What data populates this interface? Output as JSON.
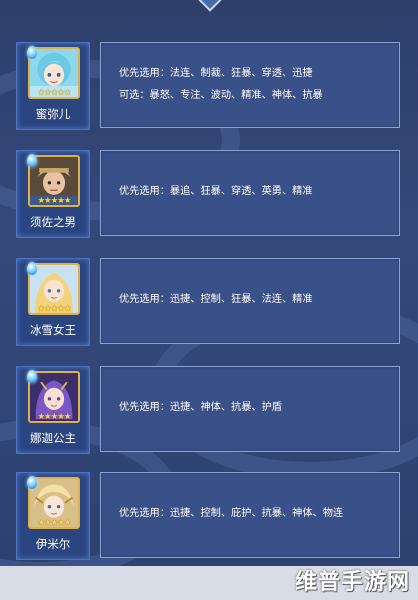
{
  "colors": {
    "panel_bg": "#34487a",
    "info_bg": "#3a5088",
    "info_border": "#8aa3d6",
    "star": "#ffd43a",
    "portrait_border": "#e0b04a"
  },
  "heroes": [
    {
      "name": "蜜弥儿",
      "stars": "★★★★★",
      "gem_icon": "blue-gem-icon",
      "lines": [
        "优先选用：法连、制裁、狂暴、穿透、迅捷",
        "可选：暴怒、专注、波动、精准、神体、抗暴"
      ]
    },
    {
      "name": "须佐之男",
      "stars": "★★★★★",
      "gem_icon": "blue-gem-icon",
      "lines": [
        "优先选用：暴追、狂暴、穿透、英勇、精准"
      ]
    },
    {
      "name": "冰雪女王",
      "stars": "★★★★★",
      "gem_icon": "blue-gem-icon",
      "lines": [
        "优先选用：迅捷、控制、狂暴、法连、精准"
      ]
    },
    {
      "name": "娜迦公主",
      "stars": "★★★★★",
      "gem_icon": "blue-gem-icon",
      "lines": [
        "优先选用：迅捷、神体、抗暴、护盾"
      ]
    },
    {
      "name": "伊米尔",
      "stars": "★★★★★",
      "gem_icon": "blue-gem-icon",
      "lines": [
        "优先选用：迅捷、控制、庇护、抗暴、神体、物连"
      ]
    }
  ],
  "watermark": "维普手游网"
}
